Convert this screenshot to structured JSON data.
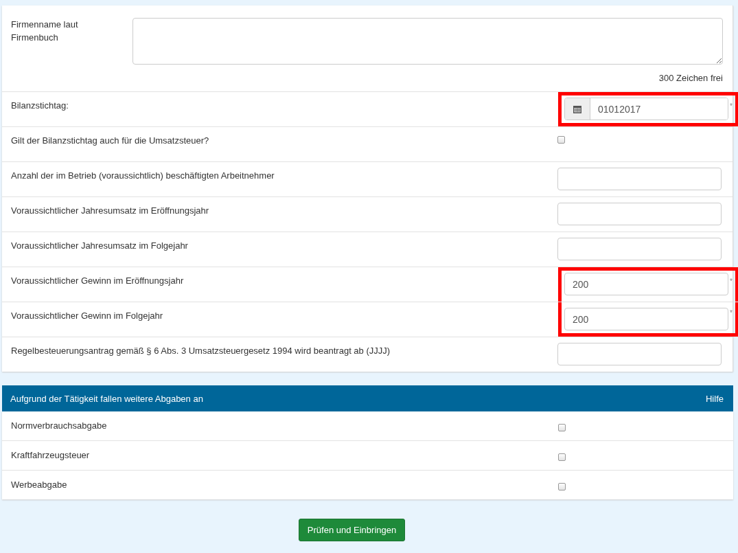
{
  "company_name": {
    "label": "Firmenname laut Firmenbuch",
    "counter": "300 Zeichen frei"
  },
  "fields": [
    {
      "kind": "date",
      "label": "Bilanzstichtag:",
      "value": "01012017",
      "required": true,
      "highlighted": true
    },
    {
      "kind": "checkbox",
      "label": "Gilt der Bilanzstichtag auch für die Umsatzsteuer?",
      "checked": false,
      "required": false,
      "highlighted": false
    },
    {
      "kind": "text",
      "label": "Anzahl der im Betrieb (voraussichtlich) beschäftigten Arbeitnehmer",
      "required": false,
      "highlighted": false
    },
    {
      "kind": "text",
      "label": "Voraussichtlicher Jahresumsatz im Eröffnungsjahr",
      "required": false,
      "highlighted": false
    },
    {
      "kind": "text",
      "label": "Voraussichtlicher Jahresumsatz im Folgejahr",
      "required": false,
      "highlighted": false
    },
    {
      "kind": "text",
      "label": "Voraussichtlicher Gewinn im Eröffnungsjahr",
      "value": "200",
      "required": true,
      "highlighted": true
    },
    {
      "kind": "text",
      "label": "Voraussichtlicher Gewinn im Folgejahr",
      "value": "200",
      "required": true,
      "highlighted": true
    },
    {
      "kind": "text",
      "label": "Regelbesteuerungsantrag gemäß § 6 Abs. 3 Umsatzsteuergesetz 1994 wird beantragt ab (JJJJ)",
      "required": false,
      "highlighted": false
    }
  ],
  "levies": {
    "title": "Aufgrund der Tätigkeit fallen weitere Abgaben an",
    "help": "Hilfe",
    "items": [
      {
        "label": "Normverbrauchsabgabe",
        "checked": false
      },
      {
        "label": "Kraftfahrzeugsteuer",
        "checked": false
      },
      {
        "label": "Werbeabgabe",
        "checked": false
      }
    ]
  },
  "required_mark": "*",
  "submit": "Prüfen und Einbringen"
}
